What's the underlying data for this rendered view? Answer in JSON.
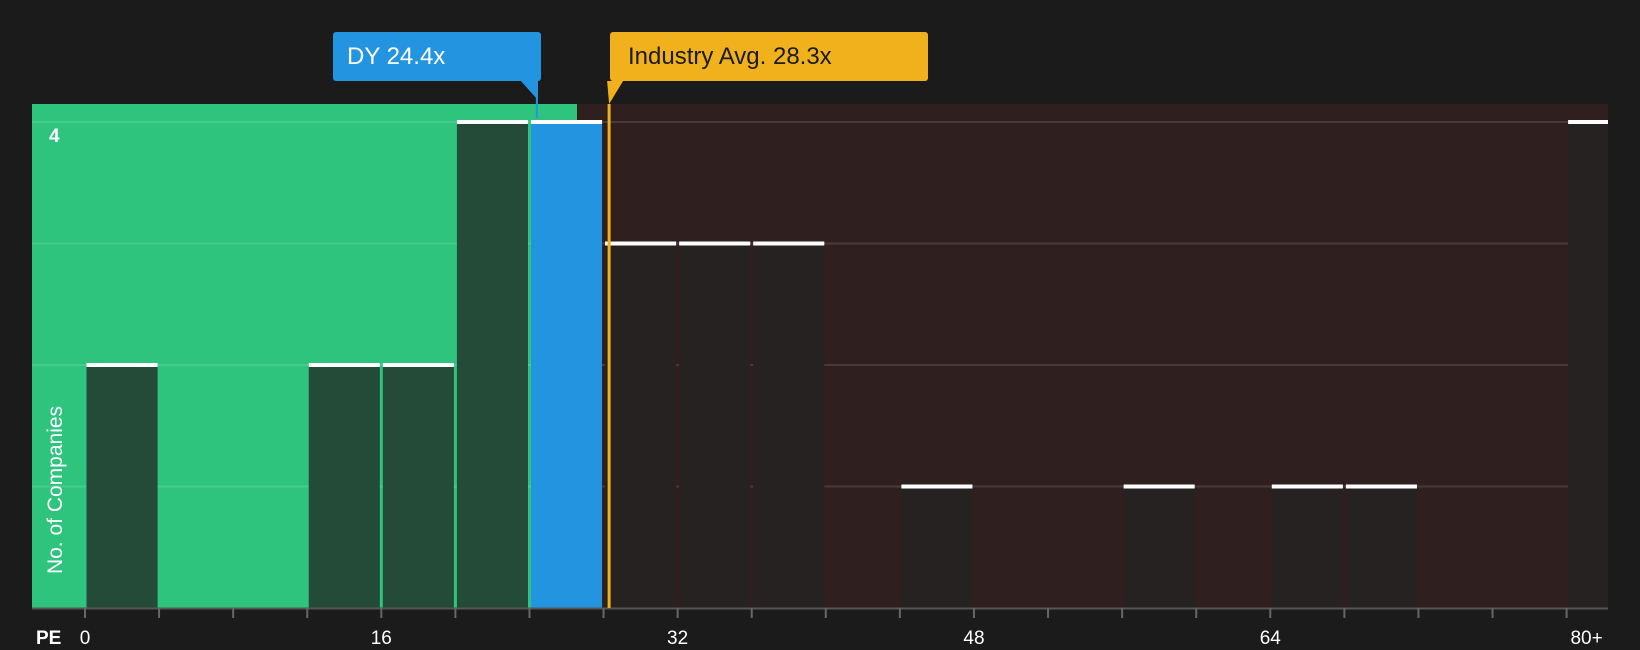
{
  "chart_data": {
    "type": "bar",
    "x_title": "PE",
    "ylabel": "No. of Companies",
    "ylim": [
      0,
      4
    ],
    "y_max_label": "4",
    "x_axis": {
      "min": 0,
      "max": 80,
      "bin_width": 4,
      "tick_step": 16
    },
    "x_tick_labels": [
      "0",
      "16",
      "32",
      "48",
      "64",
      "80+"
    ],
    "bars": [
      {
        "x_start": 0,
        "x_end": 4,
        "count": 2
      },
      {
        "x_start": 12,
        "x_end": 16,
        "count": 2
      },
      {
        "x_start": 16,
        "x_end": 20,
        "count": 2
      },
      {
        "x_start": 20,
        "x_end": 24,
        "count": 4
      },
      {
        "x_start": 24,
        "x_end": 28,
        "count": 4,
        "highlight": true
      },
      {
        "x_start": 28,
        "x_end": 32,
        "count": 3
      },
      {
        "x_start": 32,
        "x_end": 36,
        "count": 3
      },
      {
        "x_start": 36,
        "x_end": 40,
        "count": 3
      },
      {
        "x_start": 44,
        "x_end": 48,
        "count": 1
      },
      {
        "x_start": 56,
        "x_end": 60,
        "count": 1
      },
      {
        "x_start": 64,
        "x_end": 68,
        "count": 1
      },
      {
        "x_start": 68,
        "x_end": 72,
        "count": 1
      },
      {
        "x_start": 80,
        "x_end": 84,
        "count": 4
      }
    ],
    "company_label": "DY 24.4x",
    "company_value": 24.4,
    "industry_label": "Industry Avg. 28.3x",
    "industry_value": 28.3,
    "grid": true,
    "colors": {
      "undervalued_region": "#2ec47e",
      "overvalued_region": "#2f1f1f",
      "bar_in_green": "#234b38",
      "bar_in_dark": "#262222",
      "highlight_bar": "#2394e0",
      "company_callout": "#2394e0",
      "industry_callout": "#f0b11d",
      "bar_cap": "#ffffff",
      "background": "#1b1b1b"
    }
  }
}
